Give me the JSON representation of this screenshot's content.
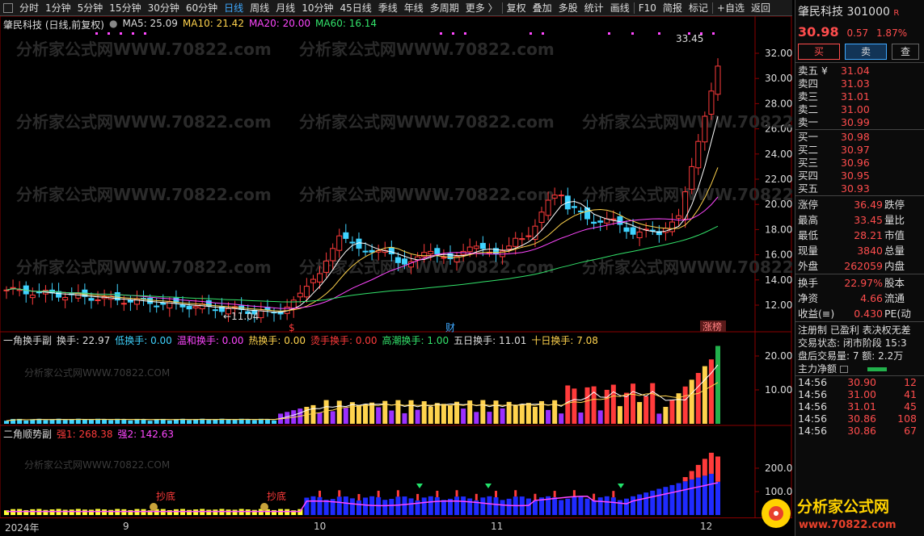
{
  "toolbar": {
    "items": [
      "分时",
      "1分钟",
      "5分钟",
      "15分钟",
      "30分钟",
      "60分钟",
      "日线",
      "周线",
      "月线",
      "10分钟",
      "45日线",
      "季线",
      "年线",
      "多周期",
      "更多 〉",
      "复权",
      "叠加",
      "多股",
      "统计",
      "画线",
      "F10",
      "简报",
      "标记",
      "+自选",
      "返回"
    ],
    "active_index": 6
  },
  "main_legend": {
    "title": "肇民科技 (日线,前复权)",
    "ma5": "MA5: 25.09",
    "ma10": "MA10: 21.42",
    "ma20": "MA20: 20.00",
    "ma60": "MA60: 16.14"
  },
  "main_chart": {
    "y_ticks": [
      "32.00",
      "30.00",
      "28.00",
      "26.00",
      "24.00",
      "22.00",
      "20.00",
      "18.00",
      "16.00",
      "14.00",
      "12.00"
    ],
    "high_label": "33.45",
    "low_label": "←11.04",
    "marker_s": "$",
    "marker_cai": "财",
    "marker_zt": "涨榜",
    "watermark": "分析家公式网WWW.70822.com"
  },
  "sub1_legend": {
    "name": "一角换手副",
    "hs": "换手: 22.97",
    "low": "低换手: 0.00",
    "warm": "温和换手: 0.00",
    "hot": "热换手: 0.00",
    "burn": "烫手换手: 0.00",
    "peak": "高潮换手: 1.00",
    "d5": "五日换手: 11.01",
    "d10": "十日换手: 7.08"
  },
  "sub1_chart": {
    "y_ticks": [
      "20.00",
      "10.00"
    ],
    "watermark": "分析家公式网WWW.70822.COM"
  },
  "sub2_legend": {
    "name": "二角顺势副",
    "q1": "强1: 268.38",
    "q2": "强2: 142.63"
  },
  "sub2_chart": {
    "y_ticks": [
      "200.0",
      "100.0"
    ],
    "watermark": "分析家公式网WWW.70822.COM",
    "chaodi": "抄底"
  },
  "date_axis": [
    "2024年",
    "9",
    "10",
    "11",
    "12"
  ],
  "quote": {
    "name": "肇民科技",
    "code": "301000",
    "tag": "R",
    "price": "30.98",
    "change": "0.57",
    "pct": "1.87%",
    "buy_btn": "买",
    "sell_btn": "卖",
    "view_btn": "查",
    "asks": [
      [
        "卖五 ¥",
        "31.04"
      ],
      [
        "卖四",
        "31.03"
      ],
      [
        "卖三",
        "31.01"
      ],
      [
        "卖二",
        "31.00"
      ],
      [
        "卖一",
        "30.99"
      ]
    ],
    "bids": [
      [
        "买一",
        "30.98"
      ],
      [
        "买二",
        "30.97"
      ],
      [
        "买三",
        "30.96"
      ],
      [
        "买四",
        "30.95"
      ],
      [
        "买五",
        "30.93"
      ]
    ],
    "stats": [
      [
        "涨停",
        "36.49",
        "跌停"
      ],
      [
        "最高",
        "33.45",
        "量比"
      ],
      [
        "最低",
        "28.21",
        "市值"
      ],
      [
        "现量",
        "3840",
        "总量"
      ],
      [
        "外盘",
        "262059",
        "内盘"
      ]
    ],
    "stats2": [
      [
        "换手",
        "22.97%",
        "股本"
      ],
      [
        "净资",
        "4.66",
        "流通"
      ],
      [
        "收益(≡)",
        "0.430",
        "PE(动"
      ]
    ],
    "reg": "注册制 已盈利 表决权无差",
    "status": "交易状态: 闭市阶段 15:3",
    "after": "盘后交易量: 7  额: 2.2万",
    "main_flow": "主力净额",
    "ticks": [
      [
        "14:56",
        "30.90",
        "12"
      ],
      [
        "14:56",
        "31.00",
        "41"
      ],
      [
        "14:56",
        "31.01",
        "45"
      ],
      [
        "14:56",
        "30.86",
        "108"
      ],
      [
        "14:56",
        "30.86",
        "67"
      ]
    ]
  },
  "logo_text": "分析家公式网",
  "logo_url": "www.70822.com"
}
